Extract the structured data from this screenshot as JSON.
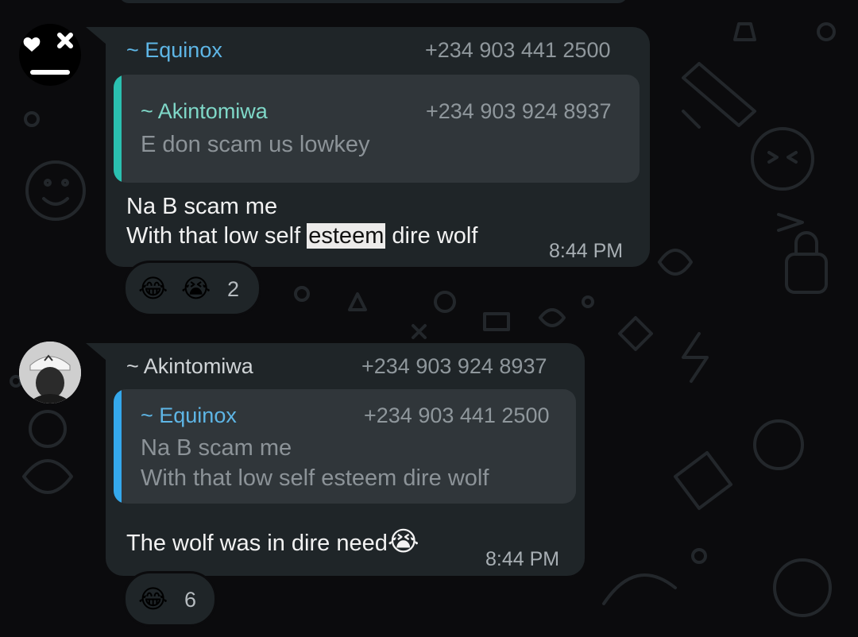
{
  "colors": {
    "background": "#0b0b0d",
    "bubble": "#1f2528",
    "quote_bg": "#30363a",
    "sender_equinox": "#5eb6e6",
    "sender_akintomiwa_in_quote": "#7fd8c8",
    "quote_bar_teal": "#2ac0b0",
    "quote_bar_blue": "#34a8ec",
    "highlight": "#ecebea"
  },
  "messages": [
    {
      "sender": "~ Equinox",
      "phone": "+234 903 441 2500",
      "avatar_icon": "heart-x-face-icon",
      "quote": {
        "sender": "~ Akintomiwa",
        "phone": "+234 903 924 8937",
        "lines": [
          "E don scam us lowkey"
        ]
      },
      "text_line1": "Na B scam me",
      "text_line2_pre": "With that low self ",
      "text_line2_highlight": "esteem",
      "text_line2_post": " dire wolf",
      "time": "8:44 PM",
      "reactions": {
        "emojis": [
          "😂",
          "😭"
        ],
        "count": "2"
      }
    },
    {
      "sender": "~ Akintomiwa",
      "phone": "+234 903 924 8937",
      "avatar_icon": "profile-photo-icon",
      "quote": {
        "sender": "~ Equinox",
        "phone": "+234 903 441 2500",
        "lines": [
          "Na B scam me",
          "With that low self esteem dire wolf"
        ]
      },
      "text": "The wolf was in dire need",
      "text_emoji": "😭",
      "time": "8:44 PM",
      "reactions": {
        "emojis": [
          "😂"
        ],
        "count": "6"
      }
    }
  ]
}
